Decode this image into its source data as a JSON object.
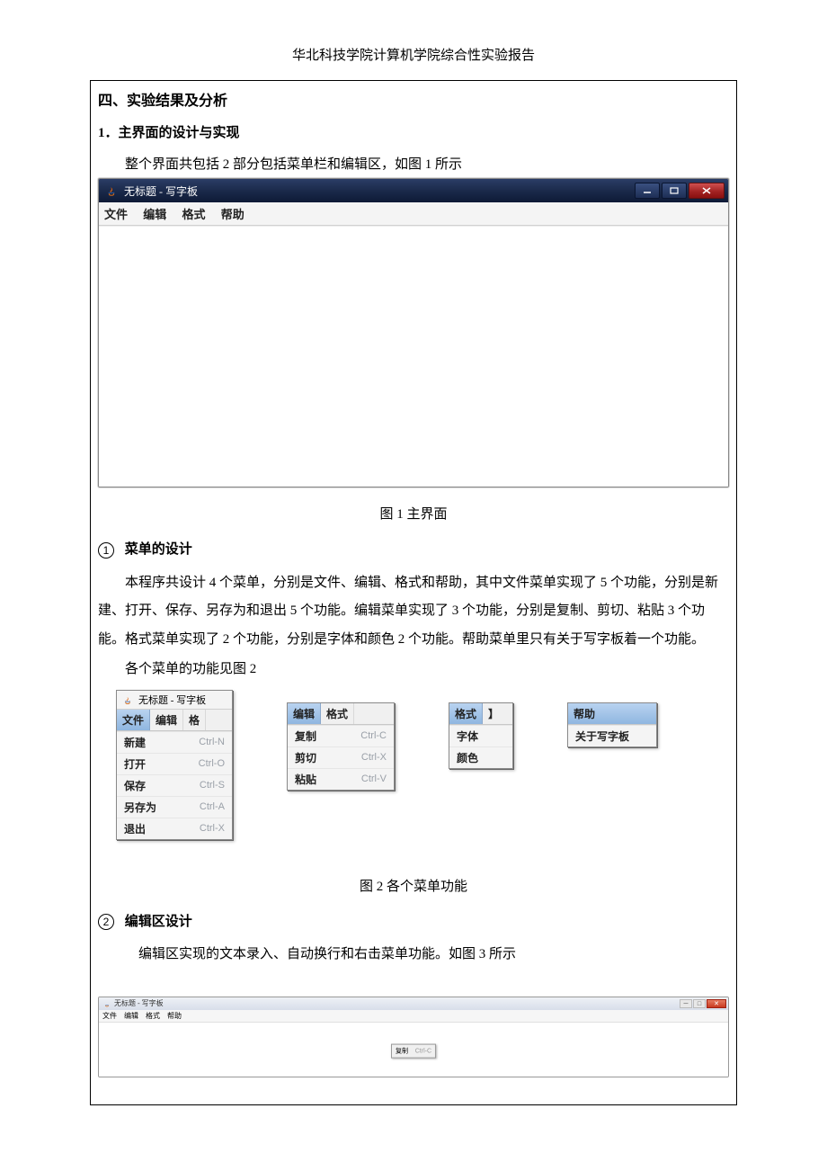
{
  "header": "华北科技学院计算机学院综合性实验报告",
  "section4": "四、实验结果及分析",
  "sub1": "1．主界面的设计与实现",
  "intro1": "整个界面共包括 2 部分包括菜单栏和编辑区，如图 1 所示",
  "win1": {
    "title": "无标题 - 写字板",
    "menu": {
      "file": "文件",
      "edit": "编辑",
      "format": "格式",
      "help": "帮助"
    }
  },
  "caption1": "图 1 主界面",
  "circled1": "①",
  "circled1_num": "1",
  "h1": "菜单的设计",
  "p1": "本程序共设计 4 个菜单，分别是文件、编辑、格式和帮助，其中文件菜单实现了 5 个功能，分别是新建、打开、保存、另存为和退出 5 个功能。编辑菜单实现了 3 个功能，分别是复制、剪切、粘贴 3 个功能。格式菜单实现了 2 个功能，分别是字体和颜色 2 个功能。帮助菜单里只有关于写字板着一个功能。",
  "p2": "各个菜单的功能见图 2",
  "menuFile": {
    "title": "无标题 - 写字板",
    "tabs": [
      "文件",
      "编辑",
      "格"
    ],
    "items": [
      {
        "label": "新建",
        "shortcut": "Ctrl-N"
      },
      {
        "label": "打开",
        "shortcut": "Ctrl-O"
      },
      {
        "label": "保存",
        "shortcut": "Ctrl-S"
      },
      {
        "label": "另存为",
        "shortcut": "Ctrl-A"
      },
      {
        "label": "退出",
        "shortcut": "Ctrl-X"
      }
    ]
  },
  "menuEdit": {
    "tabs": [
      "编辑",
      "格式"
    ],
    "items": [
      {
        "label": "复制",
        "shortcut": "Ctrl-C"
      },
      {
        "label": "剪切",
        "shortcut": "Ctrl-X"
      },
      {
        "label": "粘贴",
        "shortcut": "Ctrl-V"
      }
    ]
  },
  "menuFormat": {
    "tabs": [
      "格式",
      "】"
    ],
    "items": [
      {
        "label": "字体"
      },
      {
        "label": "颜色"
      }
    ]
  },
  "menuHelp": {
    "tabs": [
      "帮助"
    ],
    "items": [
      {
        "label": "关于写字板"
      }
    ]
  },
  "caption2": "图 2 各个菜单功能",
  "circled2_num": "2",
  "h2": "编辑区设计",
  "p3": "编辑区实现的文本录入、自动换行和右击菜单功能。如图 3 所示",
  "win3": {
    "title": "无标题 - 写字板",
    "menu": {
      "file": "文件",
      "edit": "编辑",
      "format": "格式",
      "help": "帮助"
    },
    "ctx_label": "复制",
    "ctx_shortcut": "Ctrl-C"
  }
}
